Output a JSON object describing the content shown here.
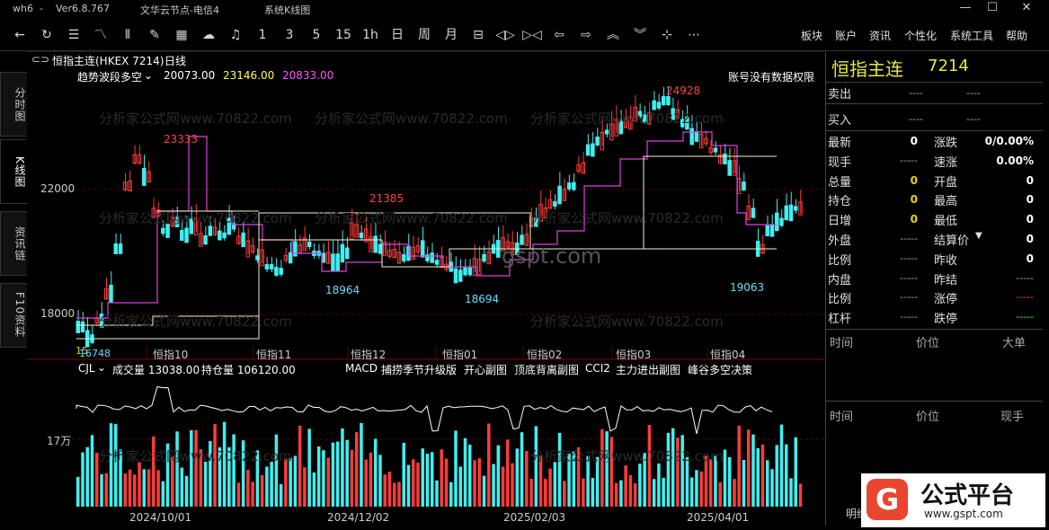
{
  "title_bar": {
    "app": "wh6",
    "sep": "-",
    "version": "Ver6.8.767",
    "server": "文华云节点-电信4",
    "page": "系统K线图"
  },
  "window_buttons": {
    "min": "—",
    "max": "☐",
    "close": "✕"
  },
  "toolbar": {
    "number_periods": [
      "1",
      "3",
      "5",
      "15",
      "1h",
      "日",
      "周",
      "月"
    ],
    "menus": [
      "板块",
      "账户",
      "资讯",
      "个性化",
      "系统工具",
      "帮助"
    ]
  },
  "left_tabs": [
    "分时图",
    "K线图",
    "资讯链",
    "F10资料"
  ],
  "chart_header": {
    "icon": "⊂⊃",
    "symbol": "恒指主连(HKEX 7214)",
    "period": "日线",
    "indicator": "趋势波段多空",
    "v1": "20073.00",
    "v2": "23146.00",
    "v3": "20833.00",
    "notice": "账号没有数据权限"
  },
  "price_axis": [
    "22000",
    "18000"
  ],
  "month_labels": [
    "恒指10",
    "恒指11",
    "恒指12",
    "恒指01",
    "恒指02",
    "恒指03",
    "恒指04"
  ],
  "peak_labels": {
    "p1": "23333",
    "p2": "21385",
    "p3": "24928",
    "t1": "18964",
    "t2": "18694",
    "t3": "19063",
    "low": "16748",
    "low_prefix": "15"
  },
  "sub_header": {
    "name": "CJL",
    "volume": "成交量 13038.00",
    "oi": "持仓量 106120.00",
    "tabs": [
      "MACD",
      "捕捞季节升级版",
      "开心副图",
      "顶底背离副图",
      "CCI2",
      "主力进出副图",
      "峰谷多空决策"
    ]
  },
  "volume_axis": "17万",
  "date_labels": [
    "2024/10/01",
    "2024/12/02",
    "2025/02/03",
    "2025/04/01"
  ],
  "watermark": "分析家公式网www.70822.com",
  "center_mark": "gspt.com",
  "quote": {
    "name": "恒指主连",
    "code": "7214",
    "sell": "卖出",
    "buy": "买入",
    "dash4": "----",
    "dash5": "-----",
    "rows_left": [
      {
        "label": "最新",
        "value": "0"
      },
      {
        "label": "现手",
        "value": "-----"
      },
      {
        "label": "总量",
        "value": "0"
      },
      {
        "label": "持仓",
        "value": "0"
      },
      {
        "label": "日增",
        "value": "0"
      },
      {
        "label": "外盘",
        "value": "-----"
      },
      {
        "label": "比例",
        "value": "-----"
      },
      {
        "label": "内盘",
        "value": "-----"
      },
      {
        "label": "比例",
        "value": "-----"
      },
      {
        "label": "杠杆",
        "value": "-----"
      }
    ],
    "rows_right": [
      {
        "label": "涨跌",
        "value": "0/0.00%"
      },
      {
        "label": "速涨",
        "value": "0.00%"
      },
      {
        "label": "开盘",
        "value": "0"
      },
      {
        "label": "最高",
        "value": "0"
      },
      {
        "label": "最低",
        "value": "0"
      },
      {
        "label": "结算价",
        "value": "0"
      },
      {
        "label": "昨收",
        "value": "0"
      },
      {
        "label": "昨结",
        "value": "-----"
      },
      {
        "label": "涨停",
        "value": "-----"
      },
      {
        "label": "跌停",
        "value": "-----"
      }
    ],
    "tick_header": {
      "time": "时间",
      "price": "价位",
      "big": "大单"
    },
    "tick_header2": {
      "time": "时间",
      "price": "价位",
      "vol": "现手"
    },
    "detail_tab": "明细"
  },
  "brand": {
    "name": "公式平台",
    "url": "www.gspt.com"
  },
  "colors": {
    "up": "#ff3b3b",
    "down": "#3ff0f0",
    "ma_white": "#f5f5c8",
    "ma_purple": "#e040e0",
    "gold": "#e8d400",
    "label_red": "#ff4040",
    "label_cyan": "#5fe0ff"
  }
}
